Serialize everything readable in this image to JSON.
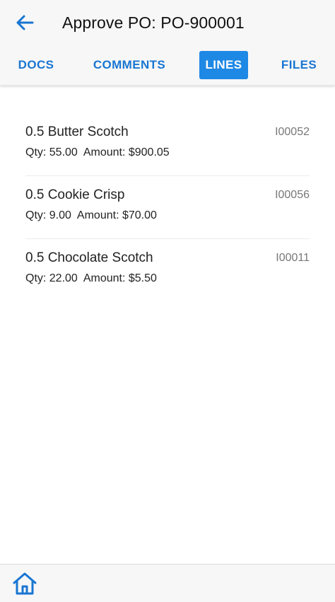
{
  "header": {
    "title": "Approve PO: PO-900001",
    "back_icon": "arrow-left-icon"
  },
  "tabs": [
    {
      "label": "DOCS",
      "active": false
    },
    {
      "label": "COMMENTS",
      "active": false
    },
    {
      "label": "LINES",
      "active": true
    },
    {
      "label": "FILES",
      "active": false
    }
  ],
  "lines": [
    {
      "name": "0.5 Butter Scotch",
      "code": "I00052",
      "qty_label": "Qty: 55.00",
      "amount_label": "Amount: $900.05"
    },
    {
      "name": "0.5 Cookie Crisp",
      "code": "I00056",
      "qty_label": "Qty: 9.00",
      "amount_label": "Amount: $70.00"
    },
    {
      "name": "0.5 Chocolate Scotch",
      "code": "I00011",
      "qty_label": "Qty: 22.00",
      "amount_label": "Amount: $5.50"
    }
  ],
  "footer": {
    "home_icon": "home-icon"
  },
  "colors": {
    "accent": "#1976d2",
    "active_tab_bg": "#1e88e5",
    "header_bg": "#f7f7f7"
  }
}
